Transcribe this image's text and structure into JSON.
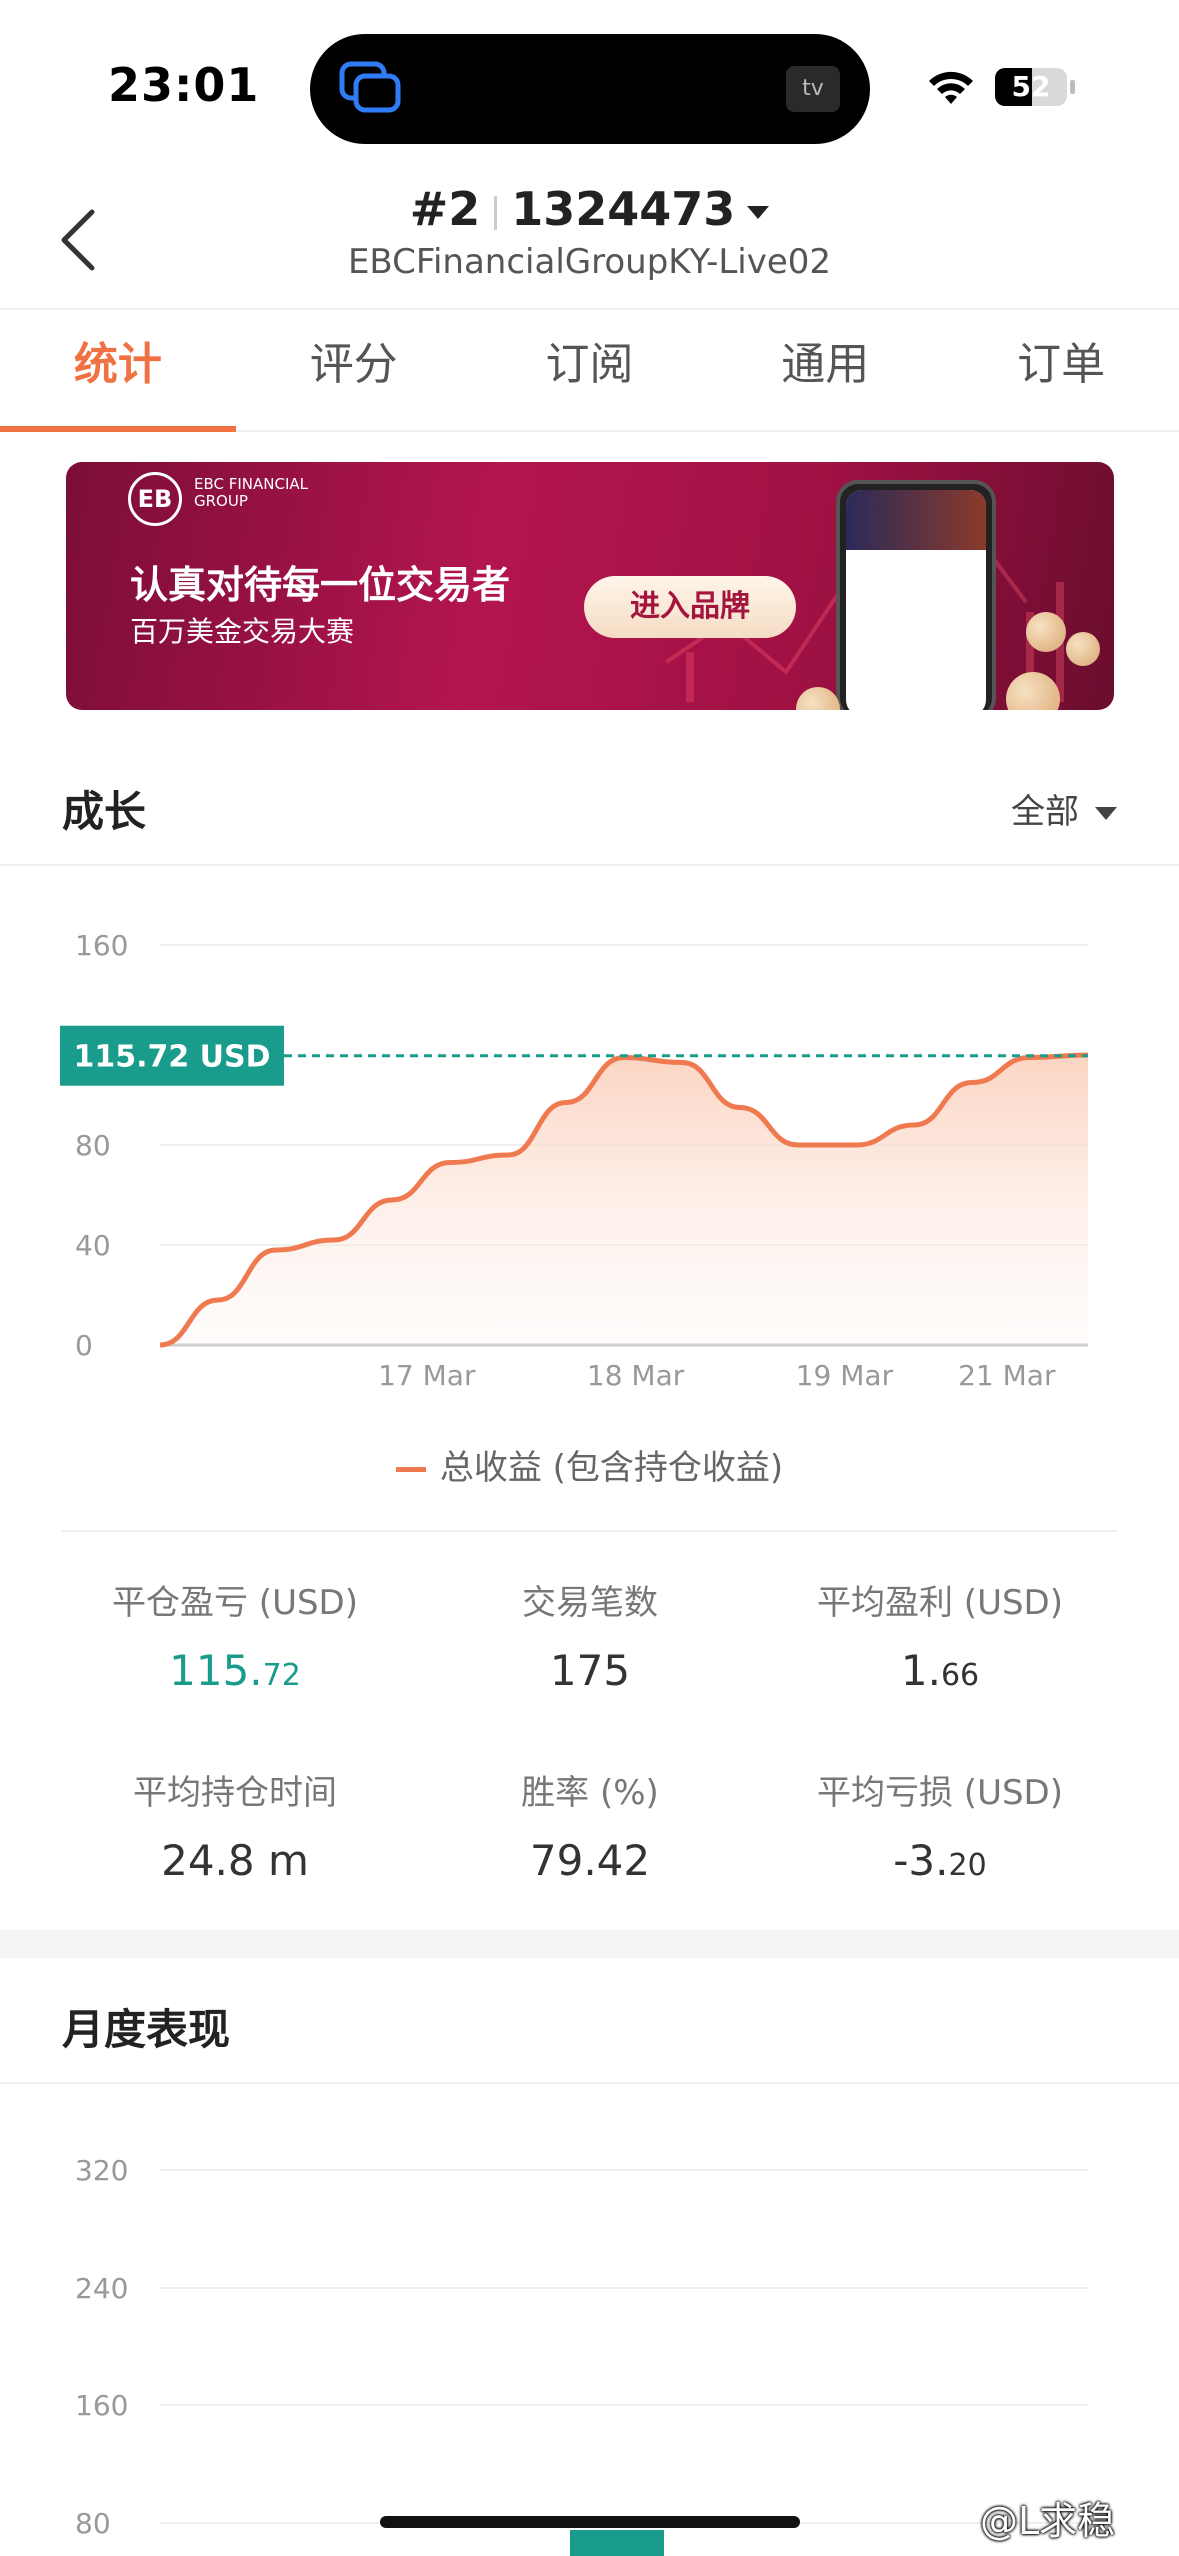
{
  "status_bar": {
    "time": "23:01",
    "battery": "52",
    "battery_level": 0.52,
    "tv_label": "tv"
  },
  "header": {
    "rank": "#2",
    "account": "1324473",
    "server": "EBCFinancialGroupKY-Live02"
  },
  "tabs": [
    "统计",
    "评分",
    "订阅",
    "通用",
    "订单"
  ],
  "active_tab": 0,
  "banner": {
    "logo_mark": "EB",
    "logo_text": "EBC FINANCIAL GROUP",
    "headline": "认真对待每一位交易者",
    "sub": "百万美金交易大赛",
    "button": "进入品牌"
  },
  "growth": {
    "title": "成长",
    "range": "全部",
    "legend": "总收益 (包含持仓收益)",
    "current_label": "115.72 USD"
  },
  "chart_data": [
    {
      "type": "area",
      "yticks": [
        "160",
        "80",
        "40",
        "0"
      ],
      "xticks": [
        "17 Mar",
        "18 Mar",
        "19 Mar",
        "21 Mar"
      ],
      "ylim": [
        0,
        160
      ],
      "series": [
        {
          "name": "总收益 (包含持仓收益)",
          "x": [
            0,
            0.25,
            0.5,
            0.75,
            1.0,
            1.25,
            1.5,
            1.75,
            2.0,
            2.25,
            2.5,
            2.75,
            3.0,
            3.25,
            3.5,
            3.75,
            4.0
          ],
          "values": [
            0,
            18,
            38,
            42,
            58,
            73,
            76,
            97,
            115,
            113,
            95,
            80,
            80,
            88,
            105,
            115,
            116
          ]
        }
      ],
      "reference_value": 115.72,
      "grid": true,
      "colors": {
        "line": "#f07a4f",
        "fill": "#fbd8c8",
        "reference": "#1a9c8c"
      }
    },
    {
      "type": "bar",
      "title": "月度表现",
      "yticks": [
        "320",
        "240",
        "160",
        "80"
      ],
      "ylim": [
        0,
        320
      ],
      "grid": true
    }
  ],
  "stats": [
    {
      "label": "平仓盈亏 (USD)",
      "int": "115.",
      "dec": "72",
      "accent": true
    },
    {
      "label": "交易笔数",
      "int": "175",
      "dec": "",
      "accent": false
    },
    {
      "label": "平均盈利 (USD)",
      "int": "1.",
      "dec": "66",
      "accent": false
    },
    {
      "label": "平均持仓时间",
      "int": "24.8 m",
      "dec": "",
      "accent": false
    },
    {
      "label": "胜率 (%)",
      "int": "79.42",
      "dec": "",
      "accent": false
    },
    {
      "label": "平均亏损 (USD)",
      "int": "-3.",
      "dec": "20",
      "accent": false
    }
  ],
  "monthly": {
    "title": "月度表现"
  },
  "watermark": "@L求稳"
}
